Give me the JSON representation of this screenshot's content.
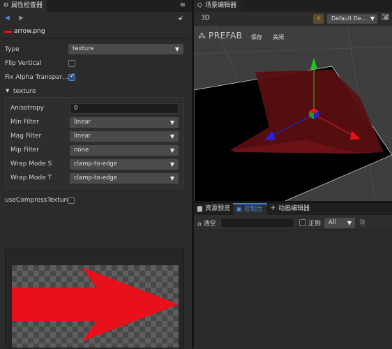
{
  "inspector": {
    "tab_title": "属性检查器",
    "menu_icon": "menu-icon",
    "asset_name": "arrow.png",
    "type_label": "Type",
    "type_value": "texture",
    "flip_vertical_label": "Flip Vertical",
    "flip_vertical_checked": false,
    "fix_alpha_label": "Fix Alpha Transpar…",
    "fix_alpha_checked": true,
    "texture_section_label": "texture",
    "anisotropy_label": "Anisotropy",
    "anisotropy_value": "0",
    "min_filter_label": "Min Filter",
    "min_filter_value": "linear",
    "mag_filter_label": "Mag Filter",
    "mag_filter_value": "linear",
    "mip_filter_label": "Mip Filter",
    "mip_filter_value": "none",
    "wrap_s_label": "Wrap Mode S",
    "wrap_s_value": "clamp-to-edge",
    "wrap_t_label": "Wrap Mode T",
    "wrap_t_value": "clamp-to-edge",
    "use_compress_label": "useCompressTexture",
    "use_compress_checked": false
  },
  "scene": {
    "tab_title": "场景编辑器",
    "mode_3d": "3D",
    "camera_dropdown": "Default De…",
    "prefab_label": "PREFAB",
    "save_label": "保存",
    "close_label": "关闭"
  },
  "bottom": {
    "tabs": [
      "资源预览",
      "控制台",
      "动画编辑器"
    ],
    "active_tab": 1,
    "clear_label": "清空",
    "search_value": "",
    "regex_label": "正则",
    "regex_checked": false,
    "level_value": "All"
  },
  "colors": {
    "accent": "#3e7bd8",
    "arrow_red": "#e8101a",
    "axis_green": "#19c81c",
    "axis_red": "#e8101a",
    "axis_blue": "#2323e8"
  }
}
